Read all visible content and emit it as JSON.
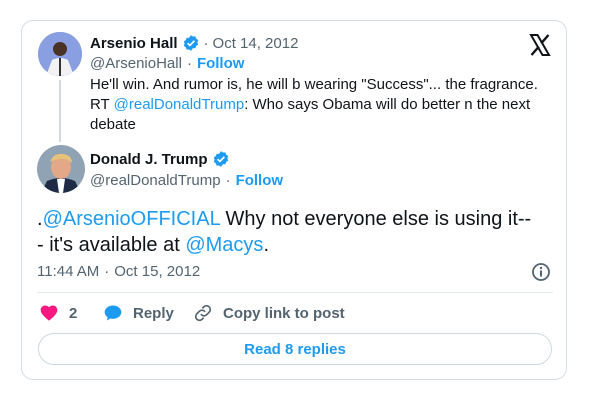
{
  "quoted": {
    "name": "Arsenio Hall",
    "date": "Oct 14, 2012",
    "handle": "@ArsenioHall",
    "follow": "Follow",
    "text_line1": "He'll win. And rumor is, he will b wearing \"Success\"... the fragrance.",
    "text_rt": "RT ",
    "mention": "@realDonaldTrump",
    "text_rest": ": Who says Obama will do better n the next debate"
  },
  "main": {
    "name": "Donald J. Trump",
    "handle": "@realDonaldTrump",
    "follow": "Follow",
    "text_prefix": ".",
    "mention1": "@ArsenioOFFICIAL",
    "text_middle": " Why not everyone else is using it--- it's available at ",
    "mention2": "@Macys",
    "text_suffix": "."
  },
  "meta": {
    "time": "11:44 AM",
    "date": "Oct 15, 2012"
  },
  "actions": {
    "like_count": "2",
    "reply_label": "Reply",
    "copy_link_label": "Copy link to post"
  },
  "read_replies_label": "Read 8 replies",
  "separator": "·",
  "icons": {
    "verified": "verified-badge-icon",
    "x_logo": "x-logo-icon",
    "info": "info-icon",
    "heart": "heart-icon",
    "reply": "reply-bubble-icon",
    "link": "link-icon"
  },
  "colors": {
    "accent": "#1d9bf0",
    "like": "#f91880",
    "muted": "#536471",
    "text": "#0f1419"
  }
}
